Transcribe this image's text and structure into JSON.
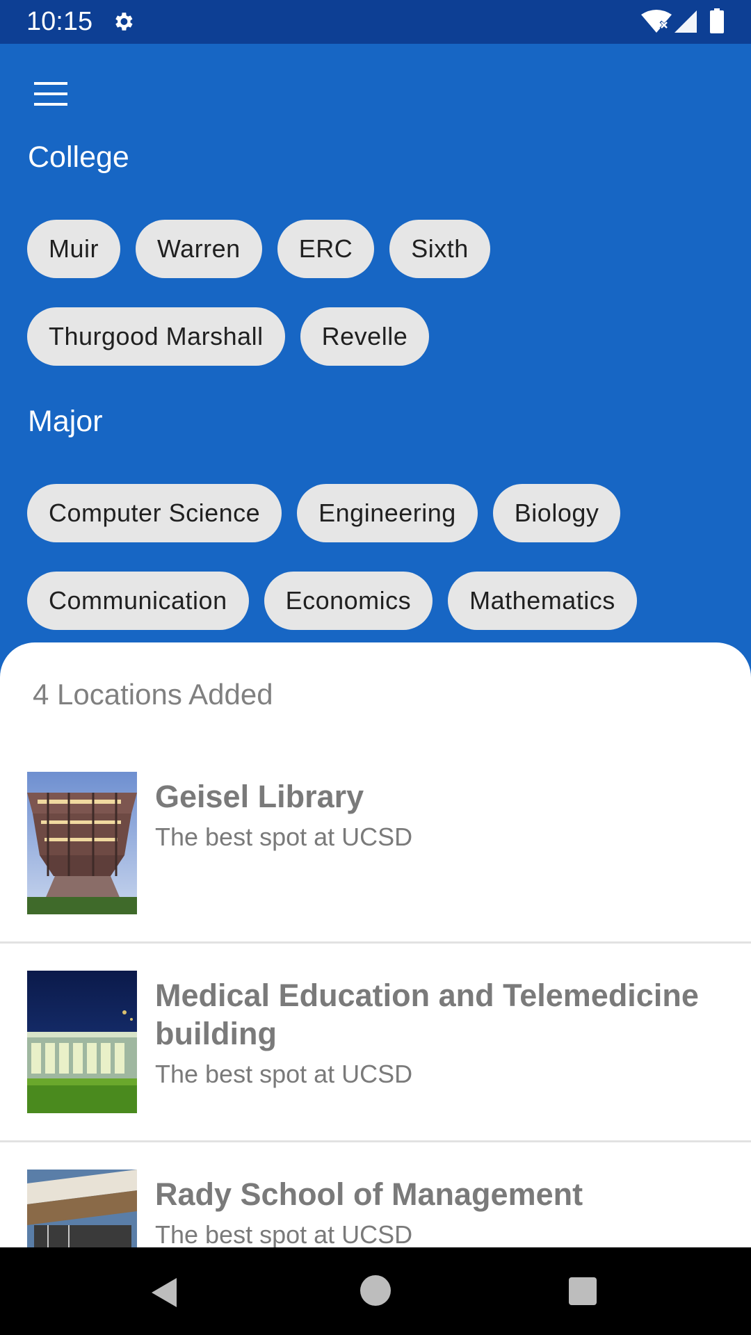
{
  "status_bar": {
    "time": "10:15",
    "icons": [
      "gear-icon",
      "wifi-icon",
      "signal-icon",
      "battery-icon"
    ]
  },
  "header": {
    "menu_icon": "hamburger-menu-icon"
  },
  "college": {
    "title": "College",
    "chips": [
      "Muir",
      "Warren",
      "ERC",
      "Sixth",
      "Thurgood Marshall",
      "Revelle"
    ]
  },
  "major": {
    "title": "Major",
    "chips": [
      "Computer Science",
      "Engineering",
      "Biology",
      "Communication",
      "Economics",
      "Mathematics"
    ]
  },
  "locations": {
    "count_label": "4 Locations Added",
    "items": [
      {
        "title": "Geisel Library",
        "description": "The best spot at UCSD"
      },
      {
        "title": "Medical Education and Telemedicine building",
        "description": "The best spot at UCSD"
      },
      {
        "title": "Rady School of Management",
        "description": "The best spot at UCSD"
      }
    ]
  },
  "nav_bar": {
    "icons": [
      "back-icon",
      "home-icon",
      "recents-icon"
    ]
  },
  "colors": {
    "primary": "#1766c4",
    "status_bar": "#0d3f94",
    "chip_bg": "#e6e6e6",
    "text_gray": "#7a7a7a"
  }
}
